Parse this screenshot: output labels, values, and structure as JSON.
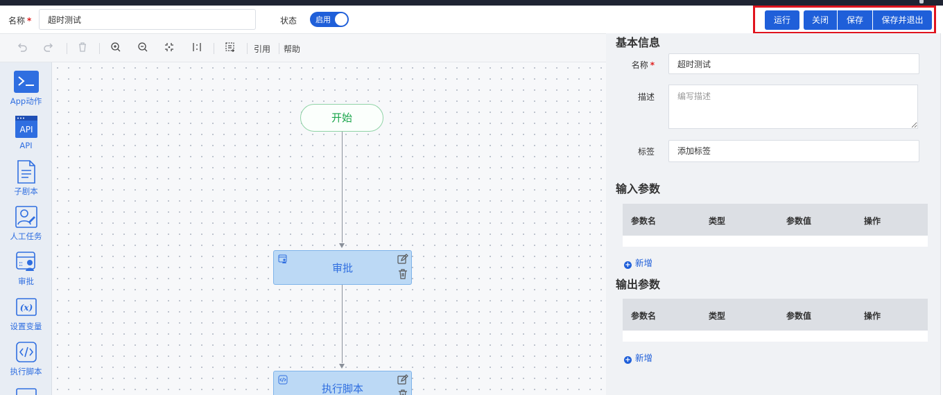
{
  "header": {
    "name_label": "名称",
    "required_mark": "*",
    "name_value": "超时测试",
    "status_label": "状态",
    "status_toggle_text": "启用",
    "buttons": {
      "run": "运行",
      "close": "关闭",
      "save": "保存",
      "save_exit": "保存并退出"
    }
  },
  "toolbar": {
    "icons": [
      "undo-icon",
      "redo-icon",
      "delete-icon",
      "zoom-in-icon",
      "zoom-out-icon",
      "fit-view-icon",
      "auto-layout-icon",
      "select-area-icon"
    ],
    "reference": "引用",
    "help": "帮助"
  },
  "palette": {
    "items": [
      {
        "label": "App动作",
        "icon": "terminal-icon"
      },
      {
        "label": "API",
        "icon": "api-icon"
      },
      {
        "label": "子剧本",
        "icon": "document-icon"
      },
      {
        "label": "人工任务",
        "icon": "manual-task-icon"
      },
      {
        "label": "审批",
        "icon": "approval-icon"
      },
      {
        "label": "设置变量",
        "icon": "variable-icon"
      },
      {
        "label": "执行脚本",
        "icon": "code-icon"
      }
    ]
  },
  "canvas": {
    "start": "开始",
    "nodes": [
      {
        "title": "审批",
        "icon": "approval-icon"
      },
      {
        "title": "执行脚本",
        "icon": "code-icon"
      }
    ]
  },
  "panel": {
    "basic_info": {
      "title": "基本信息",
      "name_label": "名称",
      "name_value": "超时测试",
      "desc_label": "描述",
      "desc_placeholder": "编写描述",
      "tags_label": "标签",
      "tags_placeholder": "添加标签"
    },
    "input_params": {
      "title": "输入参数",
      "columns": [
        "参数名",
        "类型",
        "参数值",
        "操作"
      ],
      "add": "新增"
    },
    "output_params": {
      "title": "输出参数",
      "columns": [
        "参数名",
        "类型",
        "参数值",
        "操作"
      ],
      "add": "新增"
    }
  },
  "colors": {
    "primary": "#1f5fd9",
    "highlight_border": "#e0141e",
    "start_green": "#19a54a",
    "node_fill": "#bcd9f5"
  }
}
